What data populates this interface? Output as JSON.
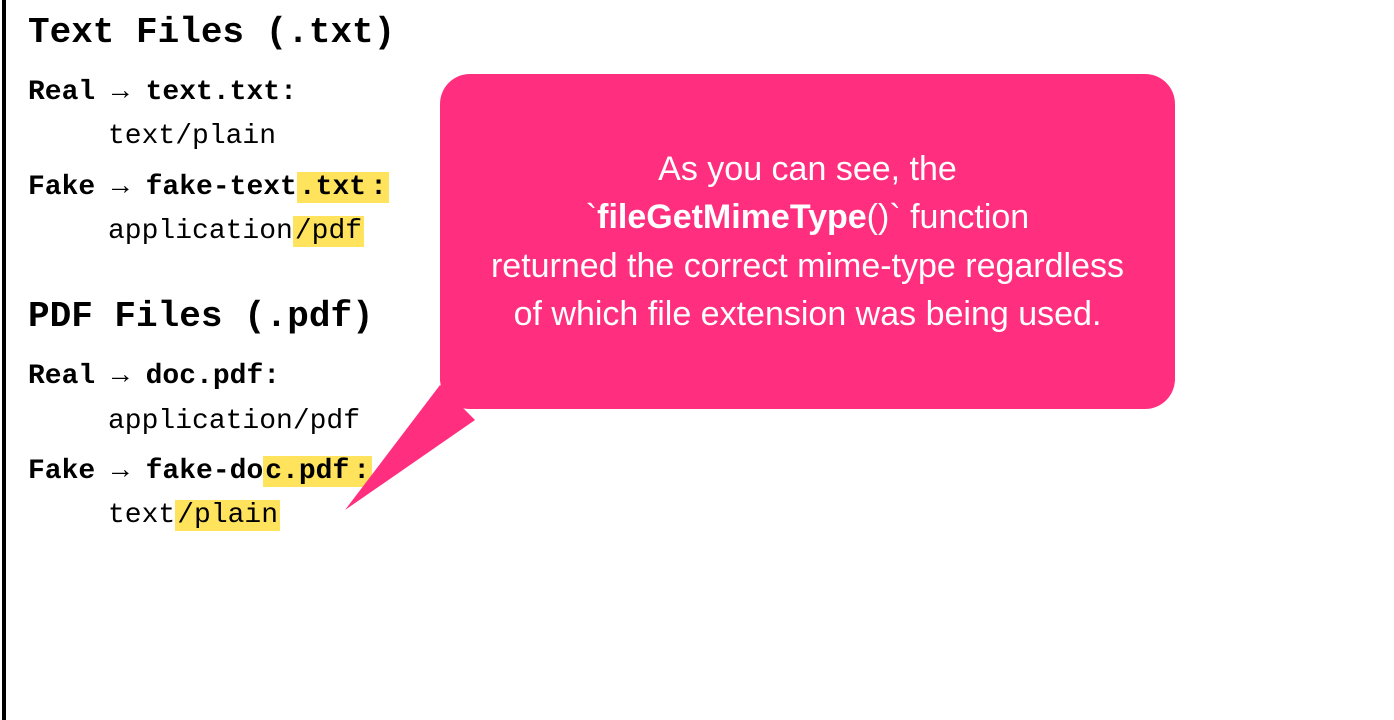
{
  "sections": {
    "text": {
      "heading": "Text Files (.txt)",
      "real": {
        "label_prefix": "Real → ",
        "filename_base": "text",
        "filename_ext": ".txt",
        "colon": ":",
        "mime_base": "text/plain",
        "mime_hl": ""
      },
      "fake": {
        "label_prefix": "Fake → ",
        "filename_base": "fake-text",
        "filename_ext": ".txt",
        "colon": ":",
        "mime_base": "application",
        "mime_hl": "/pdf"
      }
    },
    "pdf": {
      "heading": "PDF Files (.pdf)",
      "real": {
        "label_prefix": "Real → ",
        "filename_base": "doc.pdf",
        "filename_ext": "",
        "colon": ":",
        "mime_base": "application/pdf",
        "mime_hl": ""
      },
      "fake": {
        "label_prefix": "Fake → ",
        "filename_base": "fake-do",
        "filename_ext": "c.pdf",
        "colon": ":",
        "mime_base": "text",
        "mime_hl": "/plain"
      }
    }
  },
  "callout": {
    "line1": "As you can see, the",
    "code_tick": "`",
    "code_bold": "fileGetMimeType",
    "code_paren": "()",
    "line2": " function",
    "line3": "returned the correct mime-type regardless of which file extension was being used."
  },
  "colors": {
    "accent": "#ff2e7e",
    "highlight": "#ffe35c"
  }
}
